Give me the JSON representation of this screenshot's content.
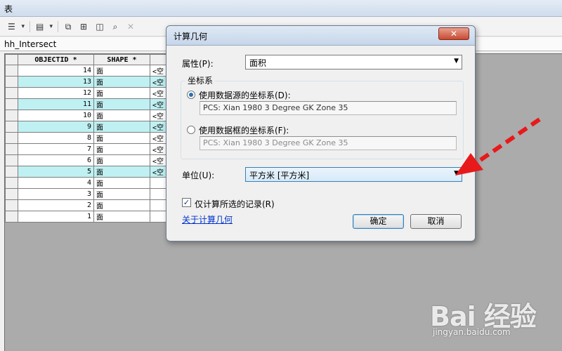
{
  "window": {
    "title": "表"
  },
  "toolbar": {
    "buttons": [
      {
        "icon": "table-options-icon"
      },
      {
        "icon": "select-by-attributes-icon"
      },
      {
        "icon": "switch-selection-icon"
      },
      {
        "icon": "clear-selection-icon"
      },
      {
        "icon": "zoom-to-selected-icon"
      },
      {
        "icon": "delete-selected-icon"
      }
    ]
  },
  "table": {
    "tab_title": "hh_Intersect",
    "columns": [
      "OBJECTID *",
      "SHAPE *"
    ],
    "rows": [
      {
        "oid": "14",
        "shape": "面",
        "area": "<空",
        "highlighted": false
      },
      {
        "oid": "13",
        "shape": "面",
        "area": "<空",
        "highlighted": true
      },
      {
        "oid": "12",
        "shape": "面",
        "area": "<空",
        "highlighted": false
      },
      {
        "oid": "11",
        "shape": "面",
        "area": "<空",
        "highlighted": true
      },
      {
        "oid": "10",
        "shape": "面",
        "area": "<空",
        "highlighted": false
      },
      {
        "oid": "9",
        "shape": "面",
        "area": "<空",
        "highlighted": true
      },
      {
        "oid": "8",
        "shape": "面",
        "area": "<空",
        "highlighted": false
      },
      {
        "oid": "7",
        "shape": "面",
        "area": "<空",
        "highlighted": false
      },
      {
        "oid": "6",
        "shape": "面",
        "area": "<空",
        "highlighted": false
      },
      {
        "oid": "5",
        "shape": "面",
        "area": "<空",
        "highlighted": true
      },
      {
        "oid": "4",
        "shape": "面",
        "area": "",
        "highlighted": false
      },
      {
        "oid": "3",
        "shape": "面",
        "area": "",
        "highlighted": false
      },
      {
        "oid": "2",
        "shape": "面",
        "area": "",
        "highlighted": false
      },
      {
        "oid": "1",
        "shape": "面",
        "area": "",
        "highlighted": false
      }
    ]
  },
  "dialog": {
    "title": "计算几何",
    "close_label": "✕",
    "property_label": "属性(P):",
    "property_value": "面积",
    "coord_group_label": "坐标系",
    "use_source_label": "使用数据源的坐标系(D):",
    "use_source_value": "PCS: Xian 1980 3 Degree GK Zone 35",
    "use_frame_label": "使用数据框的坐标系(F):",
    "use_frame_value": "PCS: Xian 1980 3 Degree GK Zone 35",
    "unit_label": "单位(U):",
    "unit_value": "平方米 [平方米]",
    "selected_only_label": "仅计算所选的记录(R)",
    "selected_only_checked": true,
    "about_link": "关于计算几何",
    "ok_label": "确定",
    "cancel_label": "取消"
  },
  "watermark": {
    "logo_text": "Bai 经验",
    "url": "jingyan.baidu.com"
  },
  "colors": {
    "highlight_row": "#bff0f2",
    "arrow": "#e8191b"
  }
}
